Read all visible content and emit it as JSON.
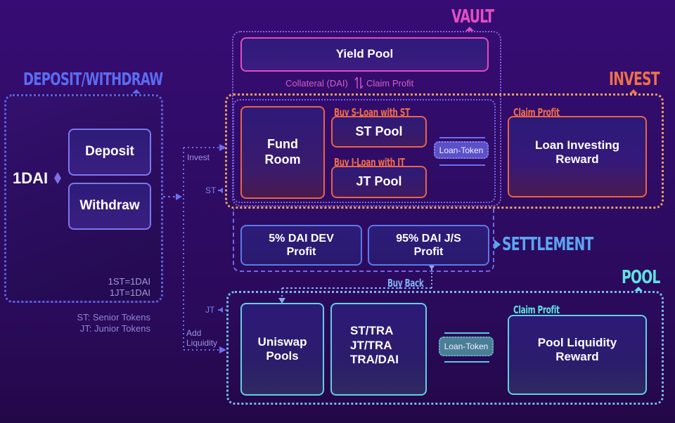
{
  "sections": {
    "deposit_withdraw": {
      "title": "DEPOSIT/WITHDRAW",
      "color": "#5b6cf0"
    },
    "vault": {
      "title": "VAULT",
      "color": "#e24fc2"
    },
    "invest": {
      "title": "INVEST",
      "color": "#ee7048"
    },
    "settlement": {
      "title": "SETTLEMENT",
      "color": "#5aa6f2"
    },
    "pool": {
      "title": "POOL",
      "color": "#5ee3e0"
    }
  },
  "deposit_withdraw": {
    "token_label": "1DAI",
    "deposit_label": "Deposit",
    "withdraw_label": "Withdraw",
    "rate_st": "1ST=1DAI",
    "rate_jt": "1JT=1DAI",
    "legend_st": "ST: Senior Tokens",
    "legend_jt": "JT: Junior Tokens"
  },
  "flows": {
    "invest": "Invest",
    "st": "ST",
    "jt": "JT",
    "add_liquidity_1": "Add",
    "add_liquidity_2": "Liquidity",
    "buy_back": "Buy Back"
  },
  "vault": {
    "yield_pool": "Yield Pool",
    "collateral": "Collateral (DAI)",
    "claim_profit": "Claim Profit"
  },
  "invest": {
    "fund_room_1": "Fund",
    "fund_room_2": "Room",
    "buy_s_loan": "Buy S-Loan with ST",
    "st_pool": "ST Pool",
    "buy_j_loan": "Buy J-Loan with JT",
    "jt_pool": "JT Pool",
    "loan_token": "Loan-Token",
    "claim_profit": "Claim Profit",
    "reward_1": "Loan Investing",
    "reward_2": "Reward"
  },
  "settlement": {
    "dev_profit_1": "5% DAI DEV",
    "dev_profit_2": "Profit",
    "js_profit_1": "95% DAI J/S",
    "js_profit_2": "Profit"
  },
  "pool": {
    "uniswap_1": "Uniswap",
    "uniswap_2": "Pools",
    "pair_1": "ST/TRA",
    "pair_2": "JT/TRA",
    "pair_3": "TRA/DAI",
    "loan_token": "Loan-Token",
    "claim_profit": "Claim Profit",
    "reward_1": "Pool Liquidity",
    "reward_2": "Reward"
  }
}
